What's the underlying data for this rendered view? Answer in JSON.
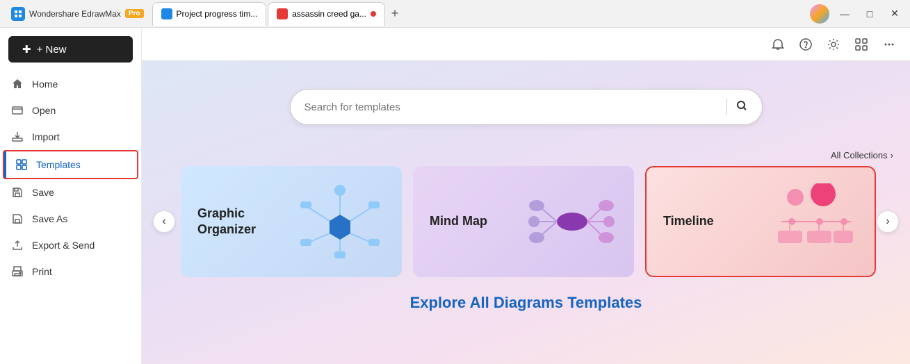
{
  "titlebar": {
    "app_name": "Wondershare EdrawMax",
    "pro_badge": "Pro",
    "tabs": [
      {
        "label": "Project progress tim...",
        "active": false,
        "closable": false
      },
      {
        "label": "assassin creed ga...",
        "active": true,
        "closable": true
      }
    ],
    "add_tab_label": "+",
    "window_controls": {
      "minimize": "—",
      "maximize": "□",
      "close": "✕"
    }
  },
  "toolbar": {
    "bell_icon": "🔔",
    "help_icon": "?",
    "settings_icon": "⚙",
    "grid_icon": "⊞",
    "more_icon": "⋯"
  },
  "sidebar": {
    "new_button": "+ New",
    "items": [
      {
        "id": "home",
        "label": "Home",
        "icon": "🏠",
        "active": false
      },
      {
        "id": "open",
        "label": "Open",
        "icon": "📄",
        "active": false
      },
      {
        "id": "import",
        "label": "Import",
        "icon": "📥",
        "active": false
      },
      {
        "id": "templates",
        "label": "Templates",
        "icon": "🗔",
        "active": true
      },
      {
        "id": "save",
        "label": "Save",
        "icon": "💾",
        "active": false
      },
      {
        "id": "save-as",
        "label": "Save As",
        "icon": "💾",
        "active": false
      },
      {
        "id": "export",
        "label": "Export & Send",
        "icon": "📤",
        "active": false
      },
      {
        "id": "print",
        "label": "Print",
        "icon": "🖨",
        "active": false
      }
    ]
  },
  "main": {
    "search_placeholder": "Search for templates",
    "search_icon": "🔍",
    "all_collections_label": "All Collections",
    "all_collections_arrow": "›",
    "nav_prev": "‹",
    "nav_next": "›",
    "cards": [
      {
        "id": "graphic-organizer",
        "label": "Graphic Organizer",
        "style": "blue",
        "selected": false
      },
      {
        "id": "mind-map",
        "label": "Mind Map",
        "style": "purple",
        "selected": false
      },
      {
        "id": "timeline",
        "label": "Timeline",
        "style": "pink",
        "selected": true
      }
    ],
    "explore_text": "Explore ",
    "explore_highlight": "All Diagrams Templates"
  }
}
